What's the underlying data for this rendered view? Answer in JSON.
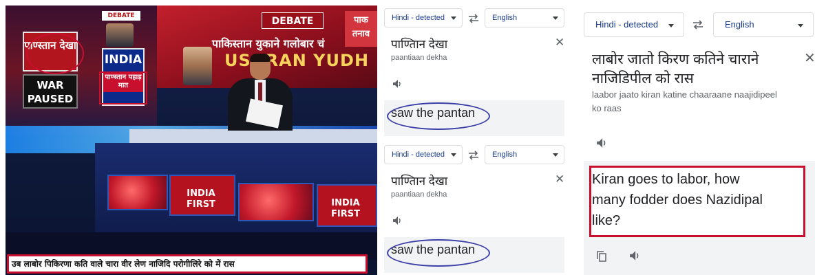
{
  "tv": {
    "debate_tag": "DEBATE",
    "debate_tag_big": "DEBATE",
    "corner_chip": "पाक तनाव",
    "card_pakistan": "पाण्स्तान देखा",
    "card_war": "WAR PAUSED",
    "card_india": "INDIA",
    "card_india_sub": "पाण्स्तान पहाड़ मात",
    "headline_hindi": "पाकिस्तान युकाने गलोबार चं",
    "headline_latin": "US-IRAN YUDH",
    "india_first_1": "INDIA FIRST",
    "india_first_2": "INDIA FIRST",
    "subtitle_text": "उब लाबोर पिकिरणा कति वाले चारा वीर लेण नाजिदि परोगीलिरे को में रास"
  },
  "translate_mid_1": {
    "source_lang": "Hindi - detected",
    "target_lang": "English",
    "source_text": "पाण्तिान देखा",
    "transliteration": "paantiaan dekha",
    "result_text": "saw the pantan"
  },
  "translate_mid_2": {
    "source_lang": "Hindi - detected",
    "target_lang": "English",
    "source_text": "पाण्तिान देखा",
    "transliteration": "paantiaan dekha",
    "result_text": "saw the pantan"
  },
  "translate_right": {
    "source_lang": "Hindi - detected",
    "target_lang": "English",
    "source_text_line1": "लाबोर जातो किरण कतिने चाराने",
    "source_text_line2": "नाजिडिपील को रास",
    "transliteration_line1": "laabor jaato kiran katine chaaraane naajidipeel",
    "transliteration_line2": "ko raas",
    "result_line1": "Kiran goes to labor, how",
    "result_line2": "many fodder does Nazidipal",
    "result_line3": "like?"
  },
  "icons": {
    "swap": "swap-arrows-icon",
    "close": "close-icon",
    "speaker": "speaker-icon",
    "copy": "copy-icon"
  },
  "colors": {
    "annotation_red": "#c8102e",
    "annotation_blue": "#3b3fa8",
    "result_bg": "#f1f3f4"
  }
}
